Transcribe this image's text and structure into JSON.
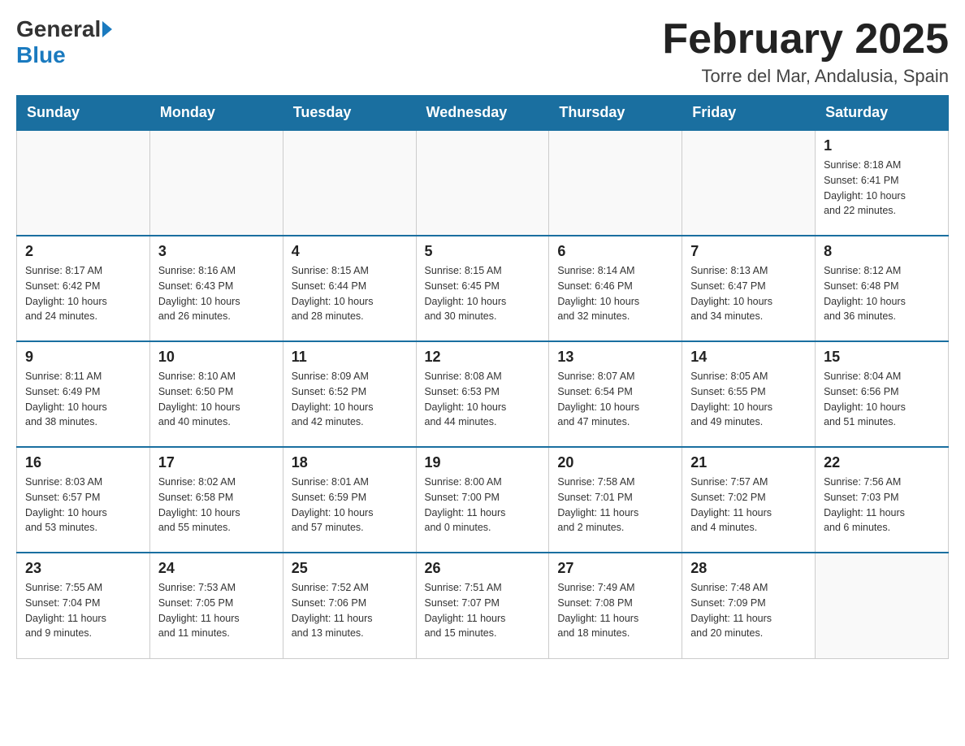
{
  "header": {
    "month_title": "February 2025",
    "location": "Torre del Mar, Andalusia, Spain",
    "logo_general": "General",
    "logo_blue": "Blue"
  },
  "days_of_week": [
    "Sunday",
    "Monday",
    "Tuesday",
    "Wednesday",
    "Thursday",
    "Friday",
    "Saturday"
  ],
  "weeks": [
    [
      {
        "day": "",
        "info": ""
      },
      {
        "day": "",
        "info": ""
      },
      {
        "day": "",
        "info": ""
      },
      {
        "day": "",
        "info": ""
      },
      {
        "day": "",
        "info": ""
      },
      {
        "day": "",
        "info": ""
      },
      {
        "day": "1",
        "info": "Sunrise: 8:18 AM\nSunset: 6:41 PM\nDaylight: 10 hours\nand 22 minutes."
      }
    ],
    [
      {
        "day": "2",
        "info": "Sunrise: 8:17 AM\nSunset: 6:42 PM\nDaylight: 10 hours\nand 24 minutes."
      },
      {
        "day": "3",
        "info": "Sunrise: 8:16 AM\nSunset: 6:43 PM\nDaylight: 10 hours\nand 26 minutes."
      },
      {
        "day": "4",
        "info": "Sunrise: 8:15 AM\nSunset: 6:44 PM\nDaylight: 10 hours\nand 28 minutes."
      },
      {
        "day": "5",
        "info": "Sunrise: 8:15 AM\nSunset: 6:45 PM\nDaylight: 10 hours\nand 30 minutes."
      },
      {
        "day": "6",
        "info": "Sunrise: 8:14 AM\nSunset: 6:46 PM\nDaylight: 10 hours\nand 32 minutes."
      },
      {
        "day": "7",
        "info": "Sunrise: 8:13 AM\nSunset: 6:47 PM\nDaylight: 10 hours\nand 34 minutes."
      },
      {
        "day": "8",
        "info": "Sunrise: 8:12 AM\nSunset: 6:48 PM\nDaylight: 10 hours\nand 36 minutes."
      }
    ],
    [
      {
        "day": "9",
        "info": "Sunrise: 8:11 AM\nSunset: 6:49 PM\nDaylight: 10 hours\nand 38 minutes."
      },
      {
        "day": "10",
        "info": "Sunrise: 8:10 AM\nSunset: 6:50 PM\nDaylight: 10 hours\nand 40 minutes."
      },
      {
        "day": "11",
        "info": "Sunrise: 8:09 AM\nSunset: 6:52 PM\nDaylight: 10 hours\nand 42 minutes."
      },
      {
        "day": "12",
        "info": "Sunrise: 8:08 AM\nSunset: 6:53 PM\nDaylight: 10 hours\nand 44 minutes."
      },
      {
        "day": "13",
        "info": "Sunrise: 8:07 AM\nSunset: 6:54 PM\nDaylight: 10 hours\nand 47 minutes."
      },
      {
        "day": "14",
        "info": "Sunrise: 8:05 AM\nSunset: 6:55 PM\nDaylight: 10 hours\nand 49 minutes."
      },
      {
        "day": "15",
        "info": "Sunrise: 8:04 AM\nSunset: 6:56 PM\nDaylight: 10 hours\nand 51 minutes."
      }
    ],
    [
      {
        "day": "16",
        "info": "Sunrise: 8:03 AM\nSunset: 6:57 PM\nDaylight: 10 hours\nand 53 minutes."
      },
      {
        "day": "17",
        "info": "Sunrise: 8:02 AM\nSunset: 6:58 PM\nDaylight: 10 hours\nand 55 minutes."
      },
      {
        "day": "18",
        "info": "Sunrise: 8:01 AM\nSunset: 6:59 PM\nDaylight: 10 hours\nand 57 minutes."
      },
      {
        "day": "19",
        "info": "Sunrise: 8:00 AM\nSunset: 7:00 PM\nDaylight: 11 hours\nand 0 minutes."
      },
      {
        "day": "20",
        "info": "Sunrise: 7:58 AM\nSunset: 7:01 PM\nDaylight: 11 hours\nand 2 minutes."
      },
      {
        "day": "21",
        "info": "Sunrise: 7:57 AM\nSunset: 7:02 PM\nDaylight: 11 hours\nand 4 minutes."
      },
      {
        "day": "22",
        "info": "Sunrise: 7:56 AM\nSunset: 7:03 PM\nDaylight: 11 hours\nand 6 minutes."
      }
    ],
    [
      {
        "day": "23",
        "info": "Sunrise: 7:55 AM\nSunset: 7:04 PM\nDaylight: 11 hours\nand 9 minutes."
      },
      {
        "day": "24",
        "info": "Sunrise: 7:53 AM\nSunset: 7:05 PM\nDaylight: 11 hours\nand 11 minutes."
      },
      {
        "day": "25",
        "info": "Sunrise: 7:52 AM\nSunset: 7:06 PM\nDaylight: 11 hours\nand 13 minutes."
      },
      {
        "day": "26",
        "info": "Sunrise: 7:51 AM\nSunset: 7:07 PM\nDaylight: 11 hours\nand 15 minutes."
      },
      {
        "day": "27",
        "info": "Sunrise: 7:49 AM\nSunset: 7:08 PM\nDaylight: 11 hours\nand 18 minutes."
      },
      {
        "day": "28",
        "info": "Sunrise: 7:48 AM\nSunset: 7:09 PM\nDaylight: 11 hours\nand 20 minutes."
      },
      {
        "day": "",
        "info": ""
      }
    ]
  ]
}
